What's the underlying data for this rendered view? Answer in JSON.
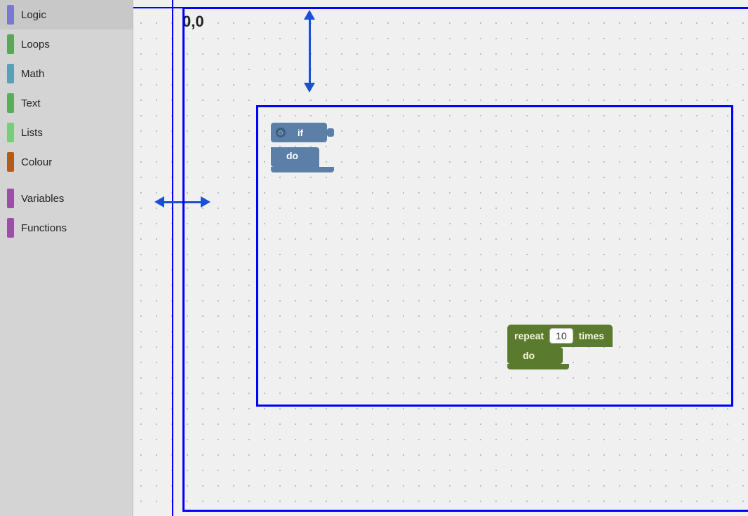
{
  "sidebar": {
    "items": [
      {
        "id": "logic",
        "label": "Logic",
        "color": "#7a7acc"
      },
      {
        "id": "loops",
        "label": "Loops",
        "color": "#5ba65b"
      },
      {
        "id": "math",
        "label": "Math",
        "color": "#5b9fb5"
      },
      {
        "id": "text",
        "label": "Text",
        "color": "#5bab5b"
      },
      {
        "id": "lists",
        "label": "Lists",
        "color": "#7acc7a"
      },
      {
        "id": "colour",
        "label": "Colour",
        "color": "#b55b1a"
      },
      {
        "id": "variables",
        "label": "Variables",
        "color": "#9b4fa6"
      },
      {
        "id": "functions",
        "label": "Functions",
        "color": "#9b4fa6"
      }
    ]
  },
  "workspace": {
    "coord_label": "0,0",
    "if_block": {
      "if_label": "if",
      "do_label": "do"
    },
    "repeat_block": {
      "repeat_label": "repeat",
      "times_label": "times",
      "do_label": "do",
      "count_value": "10"
    }
  }
}
